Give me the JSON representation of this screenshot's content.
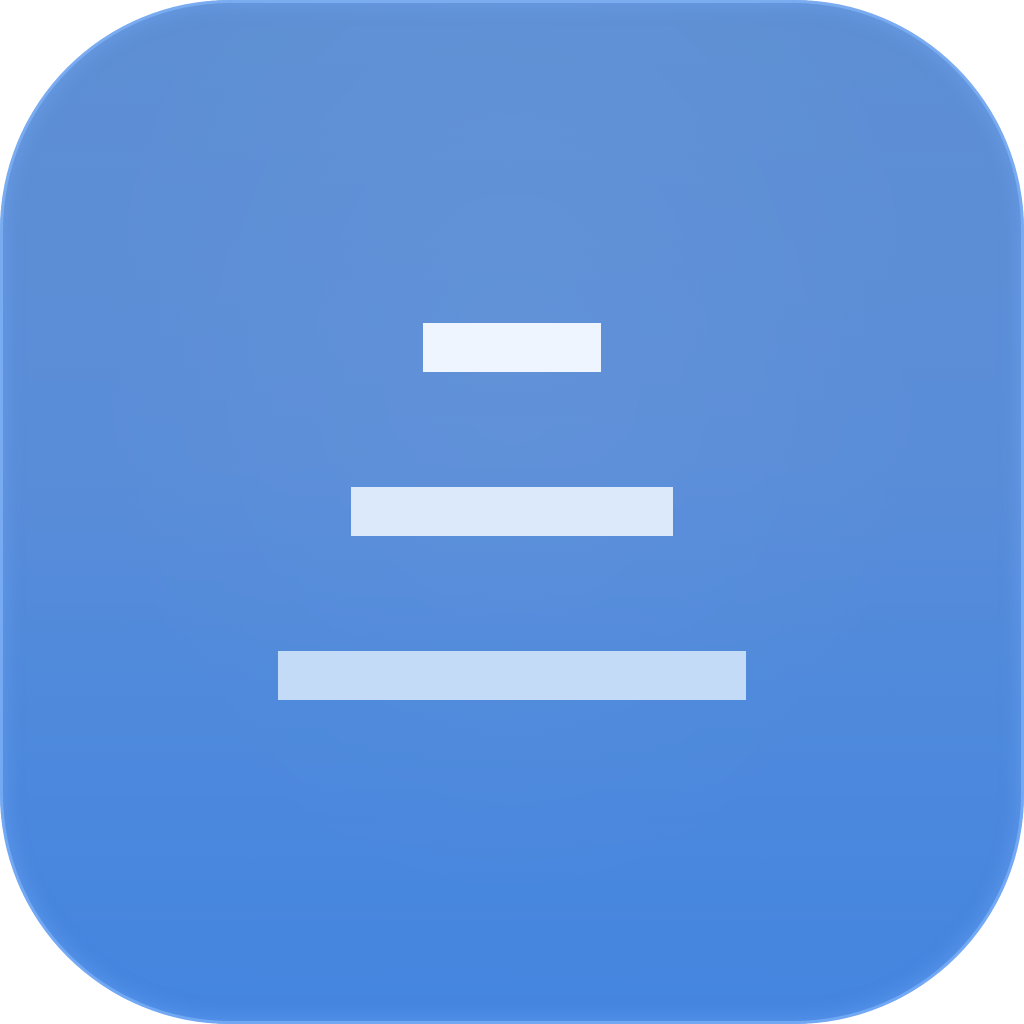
{
  "app_icon": {
    "icon": "centered-text-alignment-icon",
    "colors": {
      "tile_top": "#5e8fd4",
      "tile_bottom": "#4485e0",
      "bar_top": "#eef5fe",
      "bar_middle": "#dce9fb",
      "bar_bottom": "#c3dbf6"
    }
  }
}
